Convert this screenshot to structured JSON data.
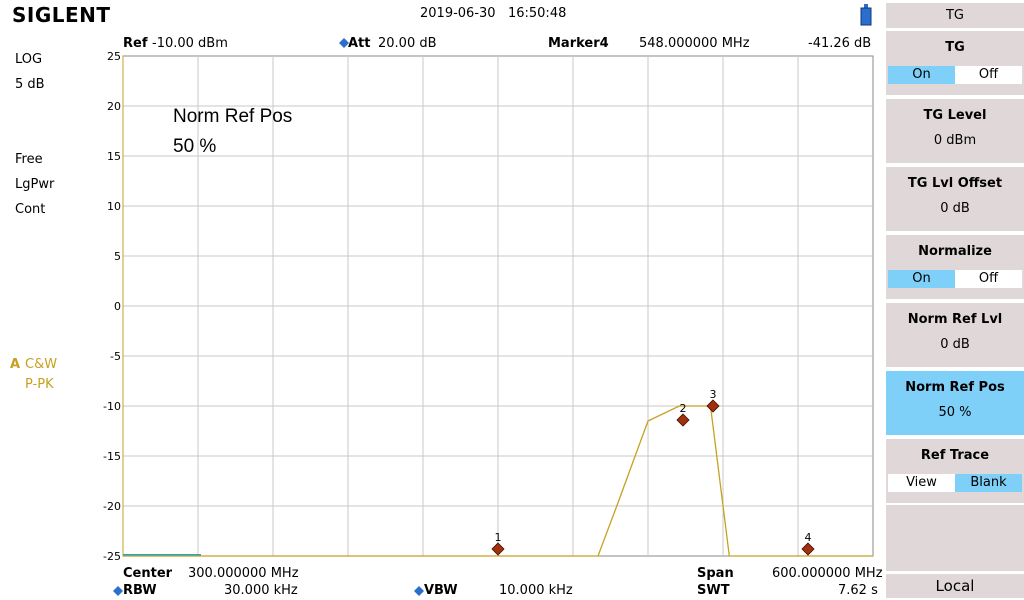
{
  "header": {
    "brand": "SIGLENT",
    "date": "2019-06-30",
    "time": "16:50:48",
    "ref_label": "Ref",
    "ref_value": "-10.00 dBm",
    "att_label": "Att",
    "att_value": "20.00 dB",
    "marker_label": "Marker4",
    "marker_freq": "548.000000 MHz",
    "marker_level": "-41.26 dB"
  },
  "left_panel": {
    "scale_type": "LOG",
    "scale_div": "5 dB",
    "trigger": "Free",
    "detector": "LgPwr",
    "sweep_mode": "Cont",
    "trace_id": "A",
    "trace_mode": "C&W",
    "trace_det": "P-PK"
  },
  "overlay": {
    "label": "Norm Ref Pos",
    "value": "50 %"
  },
  "footer": {
    "center_label": "Center",
    "center_value": "300.000000 MHz",
    "span_label": "Span",
    "span_value": "600.000000 MHz",
    "rbw_label": "RBW",
    "rbw_value": "30.000 kHz",
    "vbw_label": "VBW",
    "vbw_value": "10.000 kHz",
    "swt_label": "SWT",
    "swt_value": "7.62 s"
  },
  "menu": {
    "title": "TG",
    "tg": {
      "label": "TG",
      "on": "On",
      "off": "Off",
      "state": "On"
    },
    "tg_level": {
      "label": "TG Level",
      "value": "0 dBm"
    },
    "tg_offset": {
      "label": "TG Lvl Offset",
      "value": "0 dB"
    },
    "normalize": {
      "label": "Normalize",
      "on": "On",
      "off": "Off",
      "state": "On"
    },
    "norm_ref_lvl": {
      "label": "Norm Ref Lvl",
      "value": "0 dB"
    },
    "norm_ref_pos": {
      "label": "Norm Ref Pos",
      "value": "50 %"
    },
    "ref_trace": {
      "label": "Ref Trace",
      "view": "View",
      "blank": "Blank",
      "state": "Blank"
    },
    "local": "Local"
  },
  "colors": {
    "trace": "#c8a020",
    "marker": "#a03010",
    "active_button": "#7fd0f8",
    "button": "#e0d8d8",
    "grid": "#c8c8c8"
  },
  "chart_data": {
    "type": "line",
    "xlabel": "",
    "ylabel": "",
    "xlim": [
      0,
      600
    ],
    "ylim": [
      -25,
      25
    ],
    "y_ticks": [
      25,
      20,
      15,
      10,
      5,
      0,
      -5,
      -10,
      -15,
      -20,
      -25
    ],
    "grid": true,
    "series": [
      {
        "x": [
          0,
          380,
          395,
          420,
          445,
          470,
          485,
          600
        ],
        "values": [
          -25,
          -25,
          -20,
          -11.5,
          -10,
          -10,
          -25,
          -25
        ]
      }
    ],
    "markers": [
      {
        "id": "1",
        "x": 300,
        "y": -24.3
      },
      {
        "id": "2",
        "x": 448,
        "y": -11.4
      },
      {
        "id": "3",
        "x": 472,
        "y": -10.0
      },
      {
        "id": "4",
        "x": 548,
        "y": -24.3
      }
    ]
  }
}
